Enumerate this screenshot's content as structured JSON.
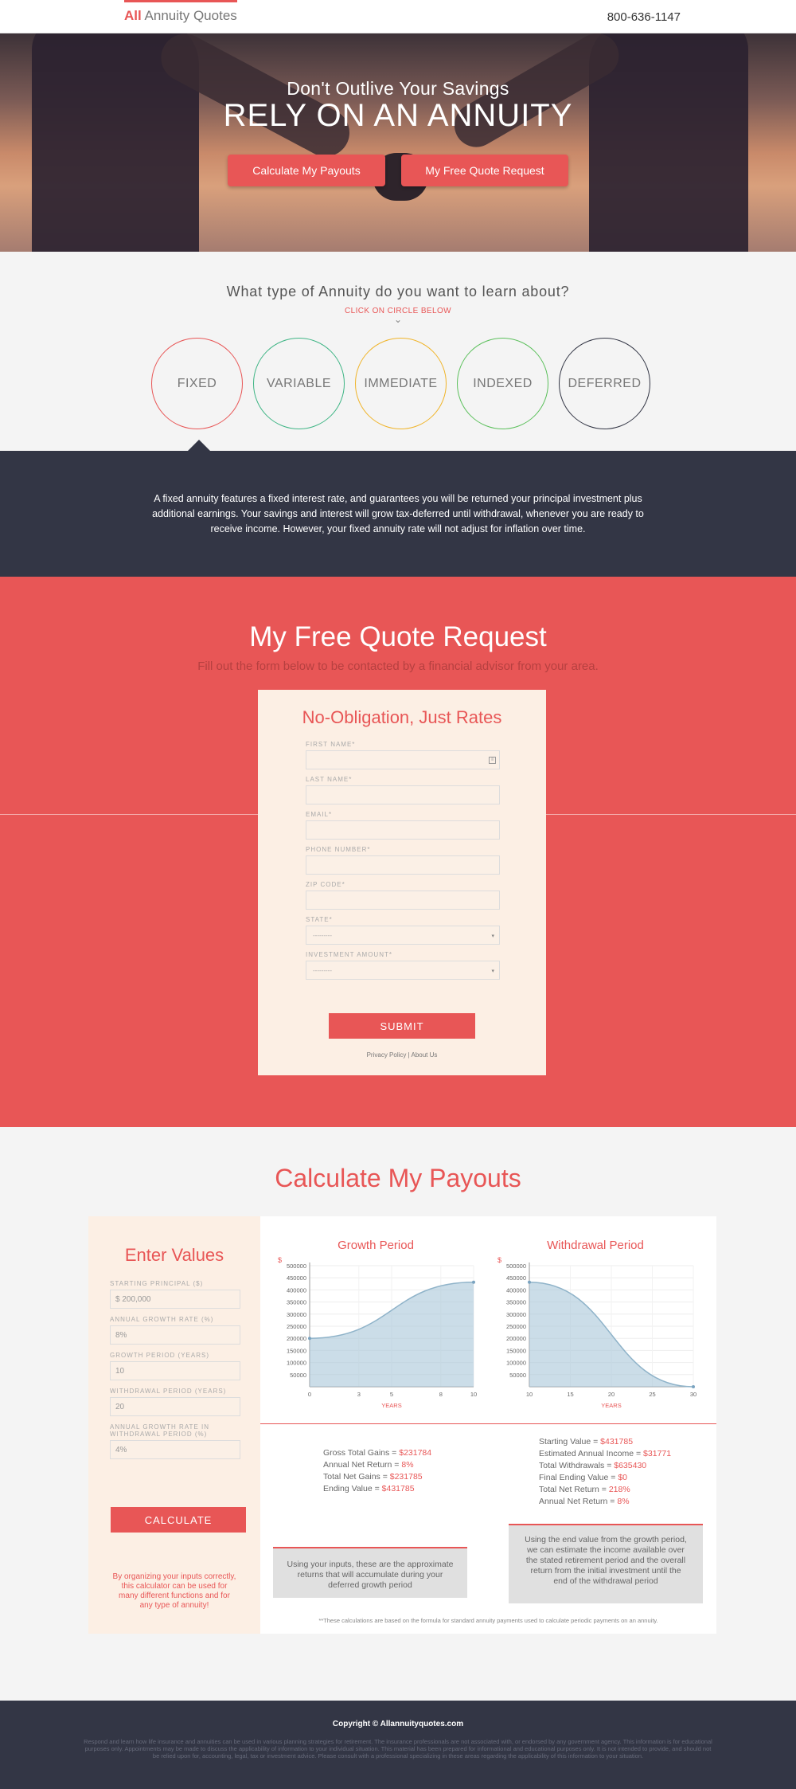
{
  "header": {
    "logo_all": "All",
    "logo_rest": "Annuity Quotes",
    "phone": "800-636-1147"
  },
  "hero": {
    "subtitle": "Don't Outlive Your Savings",
    "title": "RELY ON AN ANNUITY",
    "btn_payouts": "Calculate My Payouts",
    "btn_quote": "My Free Quote Request"
  },
  "types": {
    "question": "What type of Annuity do you want to learn about?",
    "instruction": "CLICK ON CIRCLE BELOW",
    "circles": [
      {
        "label": "FIXED",
        "color": "#e85656"
      },
      {
        "label": "VARIABLE",
        "color": "#3fb585"
      },
      {
        "label": "IMMEDIATE",
        "color": "#f0b429"
      },
      {
        "label": "INDEXED",
        "color": "#5cc05c"
      },
      {
        "label": "DEFERRED",
        "color": "#333645"
      }
    ]
  },
  "description": "A fixed annuity features a fixed interest rate, and guarantees you will be returned your principal investment plus additional earnings. Your savings and interest will grow tax-deferred until withdrawal, whenever you are ready to receive income. However, your fixed annuity rate will not adjust for inflation over time.",
  "quote": {
    "title": "My Free Quote Request",
    "subtitle": "Fill out the form below to be contacted by a financial advisor from your area.",
    "form_title": "No-Obligation, Just Rates",
    "fields": [
      {
        "label": "FIRST NAME*",
        "value": ""
      },
      {
        "label": "LAST NAME*",
        "value": ""
      },
      {
        "label": "EMAIL*",
        "value": ""
      },
      {
        "label": "PHONE NUMBER*",
        "value": ""
      },
      {
        "label": "ZIP CODE*",
        "value": ""
      },
      {
        "label": "STATE*",
        "value": "---------"
      },
      {
        "label": "INVESTMENT AMOUNT*",
        "value": "---------"
      }
    ],
    "submit": "SUBMIT",
    "privacy": "Privacy Policy",
    "separator": "|",
    "about": "About Us"
  },
  "calculator": {
    "title": "Calculate My Payouts",
    "enter_title": "Enter Values",
    "inputs": [
      {
        "label": "STARTING PRINCIPAL ($)",
        "value": "$ 200,000"
      },
      {
        "label": "ANNUAL GROWTH RATE (%)",
        "value": "8%"
      },
      {
        "label": "GROWTH PERIOD (YEARS)",
        "value": "10"
      },
      {
        "label": "WITHDRAWAL PERIOD (YEARS)",
        "value": "20"
      },
      {
        "label": "ANNUAL GROWTH RATE IN WITHDRAWAL PERIOD (%)",
        "value": "4%"
      }
    ],
    "button": "CALCULATE",
    "note": "By organizing your inputs correctly, this calculator can be used for many different functions and for any type of annuity!",
    "growth_stats": [
      {
        "label": "Gross Total Gains = ",
        "value": "$231784"
      },
      {
        "label": "Annual Net Return = ",
        "value": "8%"
      },
      {
        "label": "Total Net Gains = ",
        "value": "$231785"
      },
      {
        "label": "Ending Value = ",
        "value": "$431785"
      }
    ],
    "withdrawal_stats": [
      {
        "label": "Starting Value = ",
        "value": "$431785"
      },
      {
        "label": "Estimated Annual Income = ",
        "value": "$31771"
      },
      {
        "label": "Total Withdrawals = ",
        "value": "$635430"
      },
      {
        "label": "Final Ending Value = ",
        "value": "$0"
      },
      {
        "label": "Total Net Return = ",
        "value": "218%"
      },
      {
        "label": "Annual Net Return = ",
        "value": "8%"
      }
    ],
    "growth_summary": "Using your inputs, these are the approximate returns that will accumulate during your deferred growth period",
    "withdrawal_summary": "Using the end value from the growth period, we can estimate the income available over the stated retirement period and the overall return from the initial investment until the end of the withdrawal period",
    "disclaimer": "**These calculations are based on the formula for standard annuity payments used to calculate periodic payments on an annuity."
  },
  "chart_data": [
    {
      "type": "area",
      "title": "Growth Period",
      "ylabel": "$",
      "xlabel": "YEARS",
      "x": [
        0,
        10
      ],
      "y": [
        200000,
        431785
      ],
      "xticks": [
        "0",
        "3",
        "5",
        "8",
        "10"
      ],
      "yticks": [
        "50000",
        "100000",
        "150000",
        "200000",
        "250000",
        "300000",
        "350000",
        "400000",
        "450000",
        "500000"
      ],
      "xlim": [
        0,
        10
      ],
      "ylim": [
        0,
        500000
      ],
      "color": "#a9c6d8"
    },
    {
      "type": "area",
      "title": "Withdrawal Period",
      "ylabel": "$",
      "xlabel": "YEARS",
      "x": [
        10,
        30
      ],
      "y": [
        431785,
        0
      ],
      "xticks": [
        "10",
        "15",
        "20",
        "25",
        "30"
      ],
      "yticks": [
        "50000",
        "100000",
        "150000",
        "200000",
        "250000",
        "300000",
        "350000",
        "400000",
        "450000",
        "500000"
      ],
      "xlim": [
        10,
        30
      ],
      "ylim": [
        0,
        500000
      ],
      "color": "#a9c6d8"
    }
  ],
  "footer": {
    "copyright": "Copyright © Allannuityquotes.com",
    "legal": "Respond and learn how life insurance and annuities can be used in various planning strategies for retirement. The insurance professionals are not associated with, or endorsed by any government agency. This information is for educational purposes only. Appointments may be made to discuss the applicability of information to your individual situation. This material has been prepared for informational and educational purposes only. It is not intended to provide, and should not be relied upon for, accounting, legal, tax or investment advice. Please consult with a professional specializing in these areas regarding the applicability of this information to your situation."
  }
}
